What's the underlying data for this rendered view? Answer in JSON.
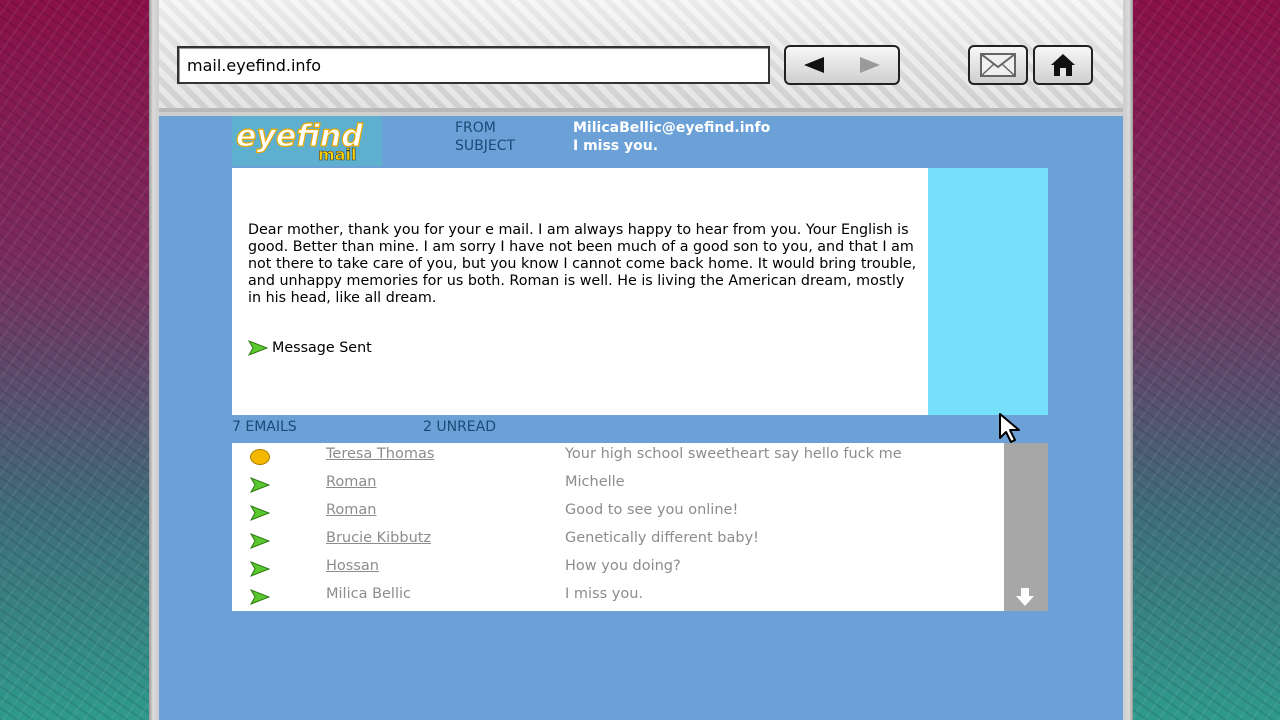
{
  "browser": {
    "url": "mail.eyefind.info",
    "icons": {
      "back": "back-arrow-icon",
      "forward": "forward-arrow-icon",
      "mail": "mail-icon",
      "home": "home-icon"
    }
  },
  "logo": {
    "line1": "eyefind",
    "line2": "mail"
  },
  "header": {
    "from_label": "FROM",
    "from_value": "MilicaBellic@eyefind.info",
    "subject_label": "SUBJECT",
    "subject_value": "I miss you."
  },
  "message": {
    "body": "Dear mother, thank you for your e mail. I am always happy to hear from you. Your English is good. Better than mine. I am sorry I have not been much of a good son to you, and that I am not there to take care of you, but you know I cannot come back home. It would bring trouble, and unhappy memories for us both. Roman is well. He is living the American dream, mostly in his head, like all dream.",
    "status": "Message Sent"
  },
  "counts": {
    "emails": "7 EMAILS",
    "unread": "2 UNREAD"
  },
  "emails": [
    {
      "sender": "Teresa Thomas",
      "subject": "Your high school sweetheart say hello fuck me",
      "icon": "unread-dot-icon"
    },
    {
      "sender": "Roman",
      "subject": "Michelle",
      "icon": "read-arrow-icon"
    },
    {
      "sender": "Roman",
      "subject": "Good to see you online!",
      "icon": "read-arrow-icon"
    },
    {
      "sender": "Brucie Kibbutz",
      "subject": "Genetically different baby!",
      "icon": "read-arrow-icon"
    },
    {
      "sender": "Hossan",
      "subject": "How you doing?",
      "icon": "read-arrow-icon"
    },
    {
      "sender": "Milica Bellic",
      "subject": "I miss you.",
      "icon": "read-arrow-icon"
    }
  ],
  "colors": {
    "background_blue": "#6ba1d6",
    "side_cyan": "#76e0fb",
    "label_blue": "#1a4b78",
    "unread_yellow": "#f5b800",
    "arrow_green": "#5ac92d"
  }
}
